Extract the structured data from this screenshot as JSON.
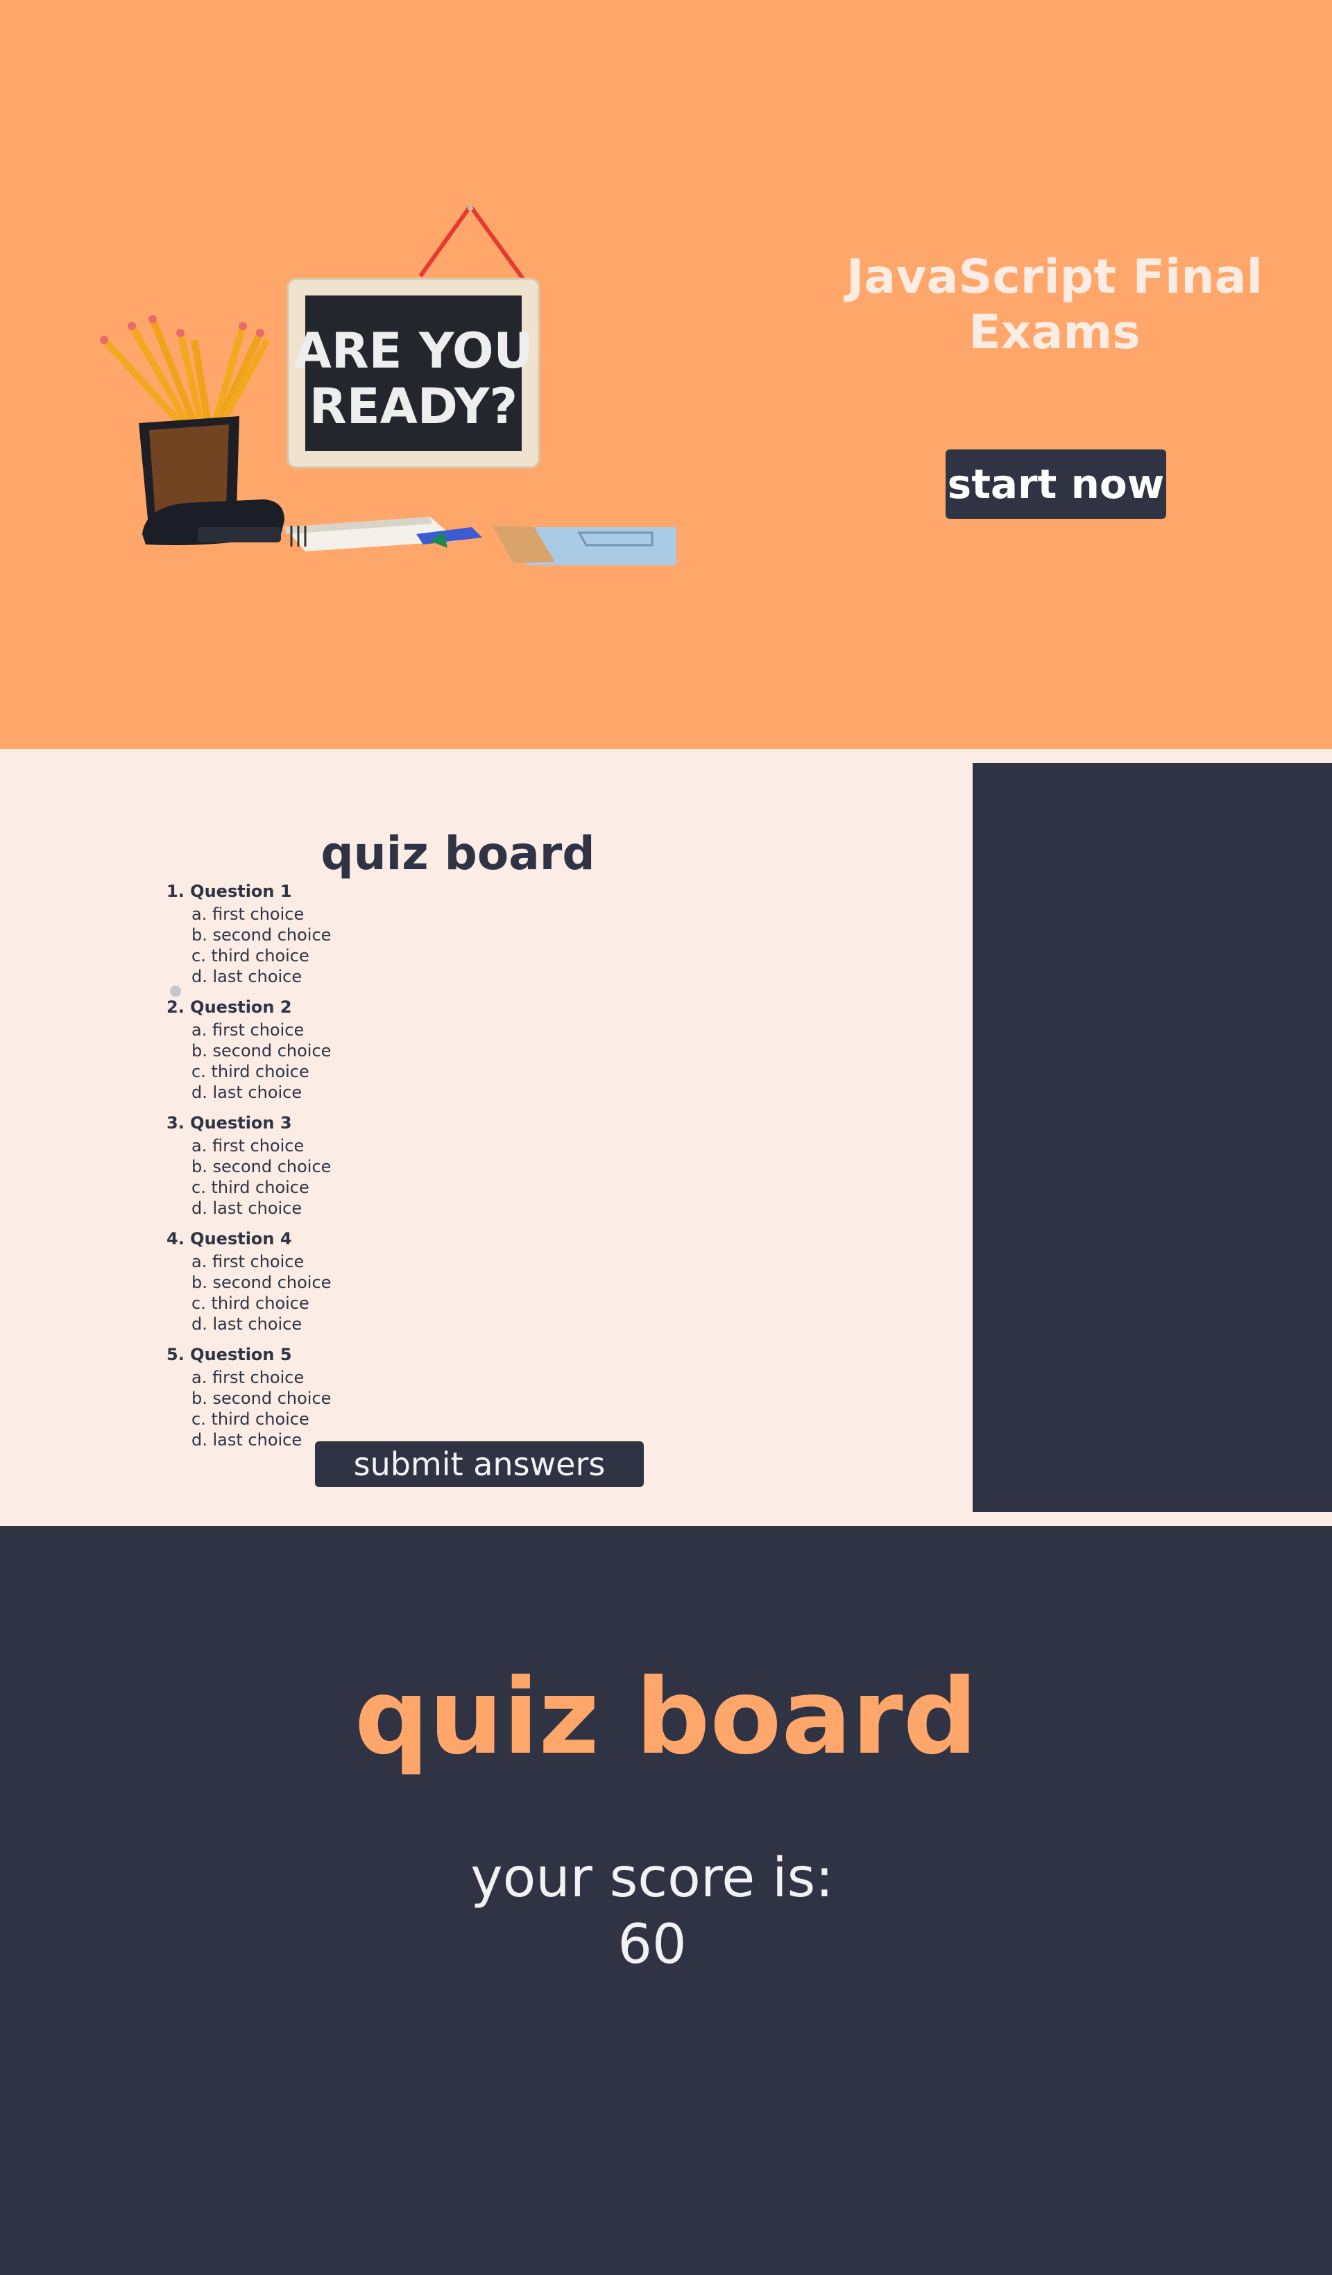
{
  "hero": {
    "title": "JavaScript Final Exams",
    "start_button": "start now",
    "illustration": {
      "board_line1": "ARE YOU",
      "board_line2": "READY?"
    },
    "colors": {
      "background": "#ffa66a",
      "title": "#fbece4",
      "button": "#2f3343"
    }
  },
  "quiz": {
    "title": "quiz board",
    "questions": [
      {
        "label": "1. Question 1",
        "choices": [
          "a. first choice",
          "b. second choice",
          "c. third choice",
          "d. last choice"
        ]
      },
      {
        "label": "2. Question 2",
        "choices": [
          "a. first choice",
          "b. second choice",
          "c. third choice",
          "d. last choice"
        ]
      },
      {
        "label": "3. Question 3",
        "choices": [
          "a. first choice",
          "b. second choice",
          "c. third choice",
          "d. last choice"
        ]
      },
      {
        "label": "4. Question 4",
        "choices": [
          "a. first choice",
          "b. second choice",
          "c. third choice",
          "d. last choice"
        ]
      },
      {
        "label": "5. Question 5",
        "choices": [
          "a. first choice",
          "b. second choice",
          "c. third choice",
          "d. last choice"
        ]
      }
    ],
    "submit_button": "submit answers",
    "colors": {
      "background": "#fbede5",
      "text": "#2f3343",
      "side_panel": "#2f3343"
    }
  },
  "result": {
    "title": "quiz board",
    "score_label": "your score is:",
    "score": "60",
    "colors": {
      "background": "#2f3343",
      "title": "#ffa66a",
      "score_text": "#f2f2f4"
    }
  }
}
